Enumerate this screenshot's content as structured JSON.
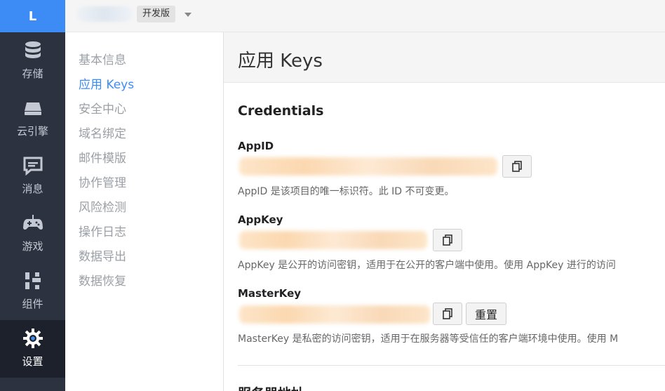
{
  "rail": {
    "logo": "L",
    "items": [
      {
        "label": "存储",
        "icon": "database-icon"
      },
      {
        "label": "云引擎",
        "icon": "server-icon"
      },
      {
        "label": "消息",
        "icon": "chat-icon"
      },
      {
        "label": "游戏",
        "icon": "gamepad-icon"
      },
      {
        "label": "组件",
        "icon": "components-icon"
      },
      {
        "label": "设置",
        "icon": "gear-icon"
      }
    ]
  },
  "topbar": {
    "version_badge": "开发版"
  },
  "submenu": {
    "items": [
      {
        "label": "基本信息"
      },
      {
        "label": "应用 Keys"
      },
      {
        "label": "安全中心"
      },
      {
        "label": "域名绑定"
      },
      {
        "label": "邮件模版"
      },
      {
        "label": "协作管理"
      },
      {
        "label": "风险检测"
      },
      {
        "label": "操作日志"
      },
      {
        "label": "数据导出"
      },
      {
        "label": "数据恢复"
      }
    ]
  },
  "main": {
    "title": "应用 Keys",
    "section_title": "Credentials",
    "fields": [
      {
        "label": "AppID",
        "help": "AppID 是该项目的唯一标识符。此 ID 不可变更。"
      },
      {
        "label": "AppKey",
        "help": "AppKey 是公开的访问密钥，适用于在公开的客户端中使用。使用 AppKey 进行的访问"
      },
      {
        "label": "MasterKey",
        "help": "MasterKey 是私密的访问密钥，适用于在服务器等受信任的客户端环境中使用。使用 M"
      }
    ],
    "reset_label": "重置",
    "next_section_title": "服务器地址"
  },
  "colors": {
    "rail_bg": "#2d3240",
    "rail_active_bg": "#1d212b",
    "accent": "#3d8cf5",
    "submenu_inactive": "#9aa0a6"
  }
}
